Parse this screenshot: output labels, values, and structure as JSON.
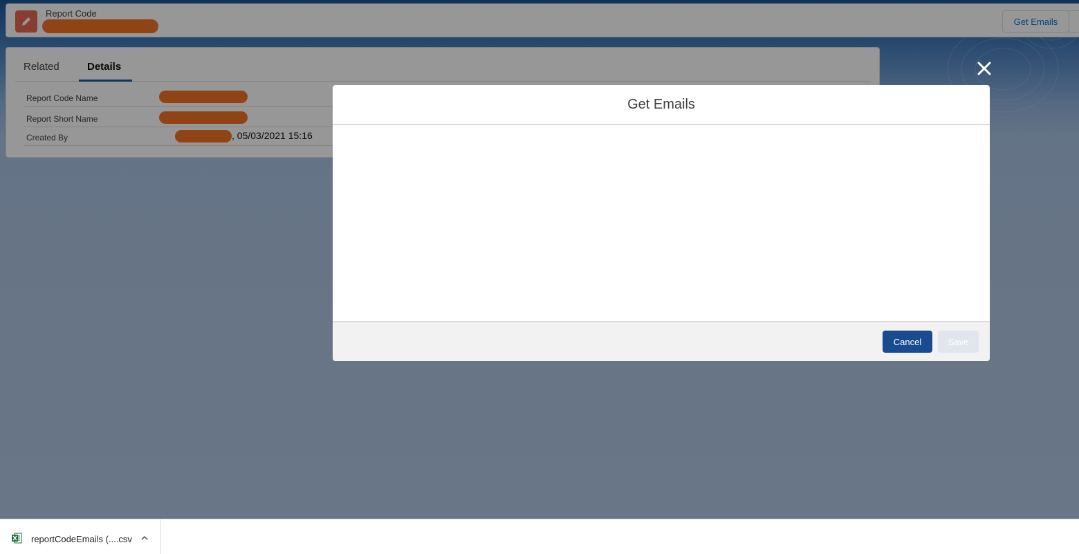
{
  "record": {
    "type_label": "Report Code",
    "header_button": "Get Emails"
  },
  "tabs": [
    {
      "label": "Related"
    },
    {
      "label": "Details"
    }
  ],
  "fields": [
    {
      "label": "Report Code Name"
    },
    {
      "label": "Report Short Name"
    },
    {
      "label": "Created By",
      "value_suffix": ", 05/03/2021 15:16"
    }
  ],
  "modal": {
    "title": "Get Emails",
    "cancel_label": "Cancel",
    "save_label": "Save"
  },
  "download": {
    "file_name": "reportCodeEmails (....csv"
  },
  "colors": {
    "brand_button": "#1b4b8f",
    "record_icon": "#e3674f",
    "redaction": "#f37021"
  },
  "icons": [
    "edit-icon",
    "avatar-icon",
    "close-icon",
    "excel-file-icon",
    "chevron-up-icon"
  ]
}
